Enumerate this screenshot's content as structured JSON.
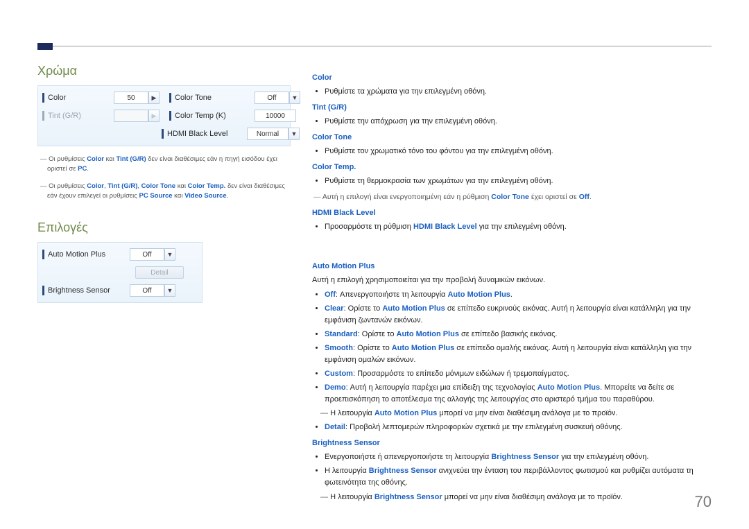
{
  "page_number": "70",
  "left": {
    "section1_title": "Χρώμα",
    "panel1": {
      "color_label": "Color",
      "color_value": "50",
      "tint_label": "Tint (G/R)",
      "colortone_label": "Color Tone",
      "colortone_value": "Off",
      "colortemp_label": "Color Temp (K)",
      "colortemp_value": "10000",
      "hdmi_label": "HDMI Black Level",
      "hdmi_value": "Normal"
    },
    "note1_pre": "Οι ρυθμίσεις ",
    "note1_kw1": "Color",
    "note1_mid1": " και ",
    "note1_kw2": "Tint (G/R)",
    "note1_mid2": " δεν είναι διαθέσιμες εάν η πηγή εισόδου έχει οριστεί σε ",
    "note1_kw3": "PC",
    "note1_end": ".",
    "note2_pre": "Οι ρυθμίσεις ",
    "note2_kw1": "Color",
    "note2_c1": ", ",
    "note2_kw2": "Tint (G/R)",
    "note2_c2": ", ",
    "note2_kw3": "Color Tone",
    "note2_c3": " και ",
    "note2_kw4": "Color Temp.",
    "note2_mid": " δεν είναι διαθέσιμες εάν έχουν επιλεγεί οι ρυθμίσεις ",
    "note2_kw5": "PC Source",
    "note2_c4": " και ",
    "note2_kw6": "Video Source",
    "note2_end": ".",
    "section2_title": "Επιλογές",
    "panel2": {
      "amp_label": "Auto Motion Plus",
      "amp_value": "Off",
      "detail_label": "Detail",
      "bs_label": "Brightness Sensor",
      "bs_value": "Off"
    }
  },
  "right": {
    "color_h": "Color",
    "color_text": "Ρυθμίστε τα χρώματα για την επιλεγμένη οθόνη.",
    "tint_h": "Tint (G/R)",
    "tint_text": "Ρυθμίστε την απόχρωση για την επιλεγμένη οθόνη.",
    "colortone_h": "Color Tone",
    "colortone_text": "Ρυθμίστε τον χρωματικό τόνο του φόντου για την επιλεγμένη οθόνη.",
    "colortemp_h": "Color Temp.",
    "colortemp_text": "Ρυθμίστε τη θερμοκρασία των χρωμάτων για την επιλεγμένη οθόνη.",
    "colortemp_note_pre": "Αυτή η επιλογή είναι ενεργοποιημένη εάν η ρύθμιση ",
    "colortemp_note_kw1": "Color Tone",
    "colortemp_note_mid": " έχει οριστεί σε ",
    "colortemp_note_kw2": "Off",
    "colortemp_note_end": ".",
    "hdmi_h": "HDMI Black Level",
    "hdmi_pre": "Προσαρμόστε τη ρύθμιση ",
    "hdmi_kw": "HDMI Black Level",
    "hdmi_end": " για την επιλεγμένη οθόνη.",
    "amp_h": "Auto Motion Plus",
    "amp_intro": "Αυτή η επιλογή χρησιμοποιείται για την προβολή δυναμικών εικόνων.",
    "amp_off_kw": "Off",
    "amp_off_mid": ": Απενεργοποιήστε τη λειτουργία ",
    "amp_off_kw2": "Auto Motion Plus",
    "amp_off_end": ".",
    "amp_clear_kw": "Clear",
    "amp_clear_mid": ": Ορίστε το ",
    "amp_clear_kw2": "Auto Motion Plus",
    "amp_clear_end": " σε επίπεδο ευκρινούς εικόνας. Αυτή η λειτουργία είναι κατάλληλη για την εμφάνιση ζωντανών εικόνων.",
    "amp_std_kw": "Standard",
    "amp_std_mid": ": Ορίστε το ",
    "amp_std_kw2": "Auto Motion Plus",
    "amp_std_end": " σε επίπεδο βασικής εικόνας.",
    "amp_smooth_kw": "Smooth",
    "amp_smooth_mid": ": Ορίστε το ",
    "amp_smooth_kw2": "Auto Motion Plus",
    "amp_smooth_end": " σε επίπεδο ομαλής εικόνας. Αυτή η λειτουργία είναι κατάλληλη για την εμφάνιση ομαλών εικόνων.",
    "amp_custom_kw": "Custom",
    "amp_custom_end": ": Προσαρμόστε το επίπεδο μόνιμων ειδώλων ή τρεμοπαίγματος.",
    "amp_demo_kw": "Demo",
    "amp_demo_mid": ": Αυτή η λειτουργία παρέχει μια επίδειξη της τεχνολογίας ",
    "amp_demo_kw2": "Auto Motion Plus",
    "amp_demo_end": ". Μπορείτε να δείτε σε προεπισκόπηση το αποτέλεσμα της αλλαγής της λειτουργίας στο αριστερό τμήμα του παραθύρου.",
    "amp_note_pre": "Η λειτουργία ",
    "amp_note_kw": "Auto Motion Plus",
    "amp_note_end": " μπορεί να μην είναι διαθέσιμη ανάλογα με το προϊόν.",
    "amp_detail_kw": "Detail",
    "amp_detail_end": ": Προβολή λεπτομερών πληροφοριών σχετικά με την επιλεγμένη συσκευή οθόνης.",
    "bs_h": "Brightness Sensor",
    "bs_l1_pre": "Ενεργοποιήστε ή απενεργοποιήστε τη λειτουργία ",
    "bs_l1_kw": "Brightness Sensor",
    "bs_l1_end": " για την επιλεγμένη οθόνη.",
    "bs_l2_pre": "Η λειτουργία ",
    "bs_l2_kw": "Brightness Sensor",
    "bs_l2_end": " ανιχνεύει την ένταση του περιβάλλοντος φωτισμού και ρυθμίζει αυτόματα τη φωτεινότητα της οθόνης.",
    "bs_note_pre": "Η λειτουργία ",
    "bs_note_kw": "Brightness Sensor",
    "bs_note_end": " μπορεί να μην είναι διαθέσιμη ανάλογα με το προϊόν."
  }
}
